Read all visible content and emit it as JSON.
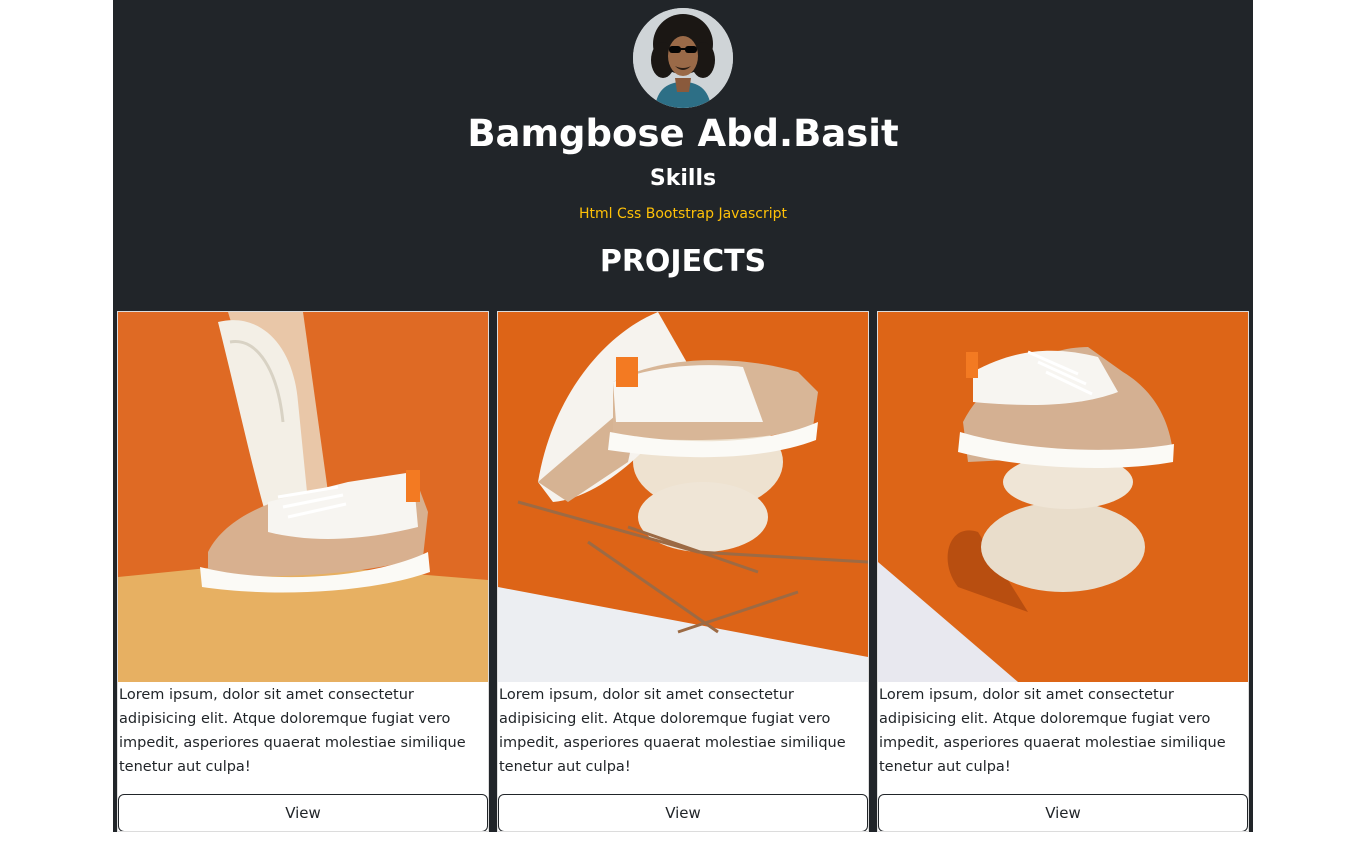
{
  "profile": {
    "name": "Bamgbose Abd.Basit",
    "skills_title": "Skills",
    "skills": "Html Css Bootstrap Javascript",
    "projects_title": "PROJECTS"
  },
  "colors": {
    "page_bg": "#212529",
    "accent": "#ffc107",
    "photo_orange": "#e0661c"
  },
  "projects": [
    {
      "description": "Lorem ipsum, dolor sit amet consectetur adipisicing elit. Atque doloremque fugiat vero impedit, asperiores quaerat molestiae similique tenetur aut culpa!",
      "button_label": "View"
    },
    {
      "description": "Lorem ipsum, dolor sit amet consectetur adipisicing elit. Atque doloremque fugiat vero impedit, asperiores quaerat molestiae similique tenetur aut culpa!",
      "button_label": "View"
    },
    {
      "description": "Lorem ipsum, dolor sit amet consectetur adipisicing elit. Atque doloremque fugiat vero impedit, asperiores quaerat molestiae similique tenetur aut culpa!",
      "button_label": "View"
    }
  ]
}
